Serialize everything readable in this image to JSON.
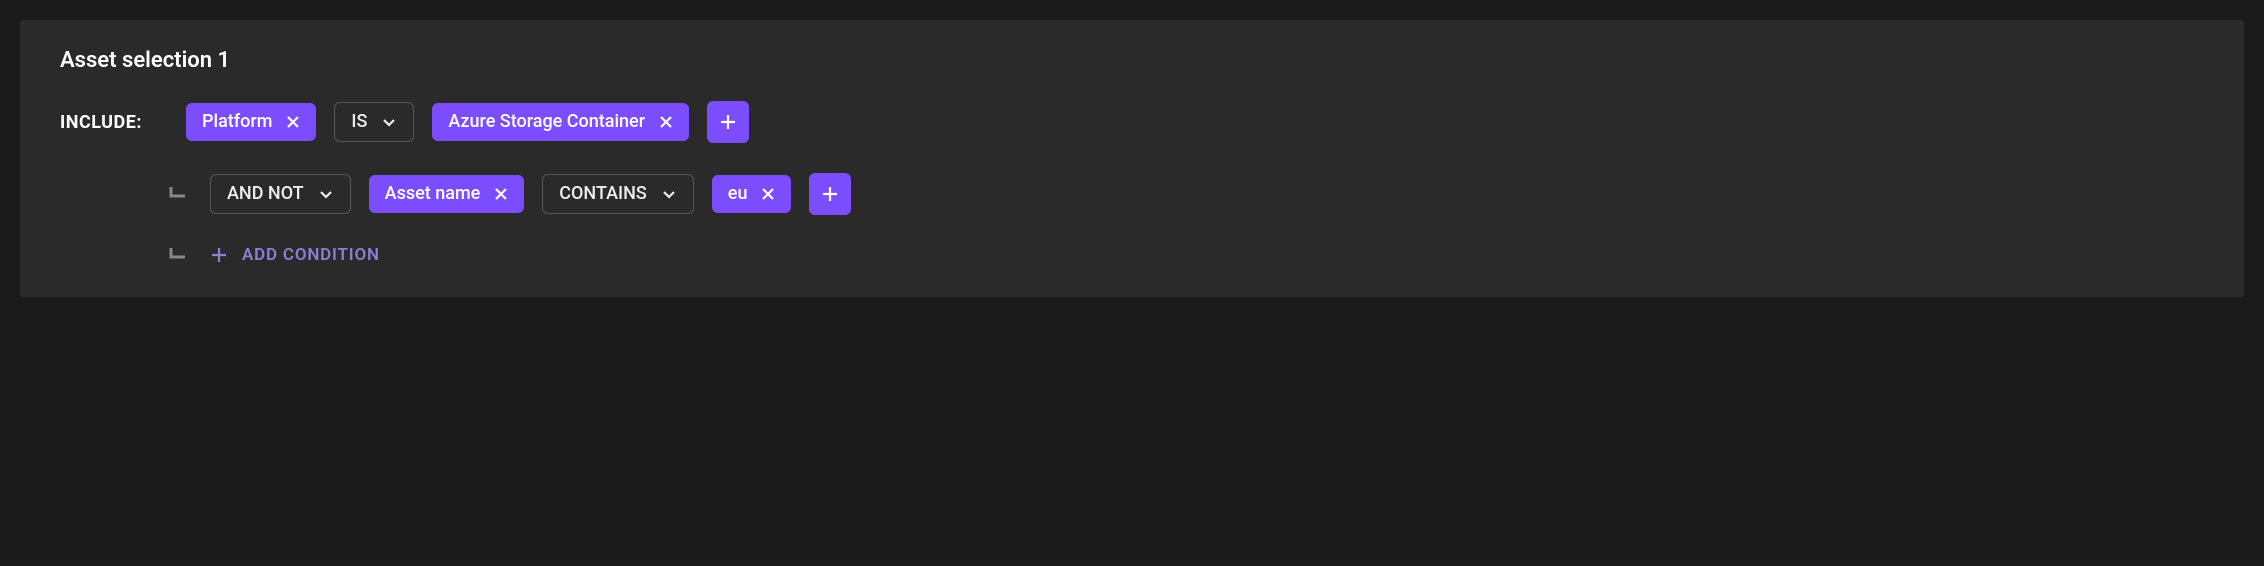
{
  "panel": {
    "title": "Asset selection 1",
    "include_label": "INCLUDE:",
    "add_condition_label": "ADD CONDITION"
  },
  "rows": {
    "0": {
      "attribute": "Platform",
      "operator": "IS",
      "value": "Azure Storage Container"
    },
    "1": {
      "logical": "AND NOT",
      "attribute": "Asset name",
      "operator": "CONTAINS",
      "value": "eu"
    }
  }
}
